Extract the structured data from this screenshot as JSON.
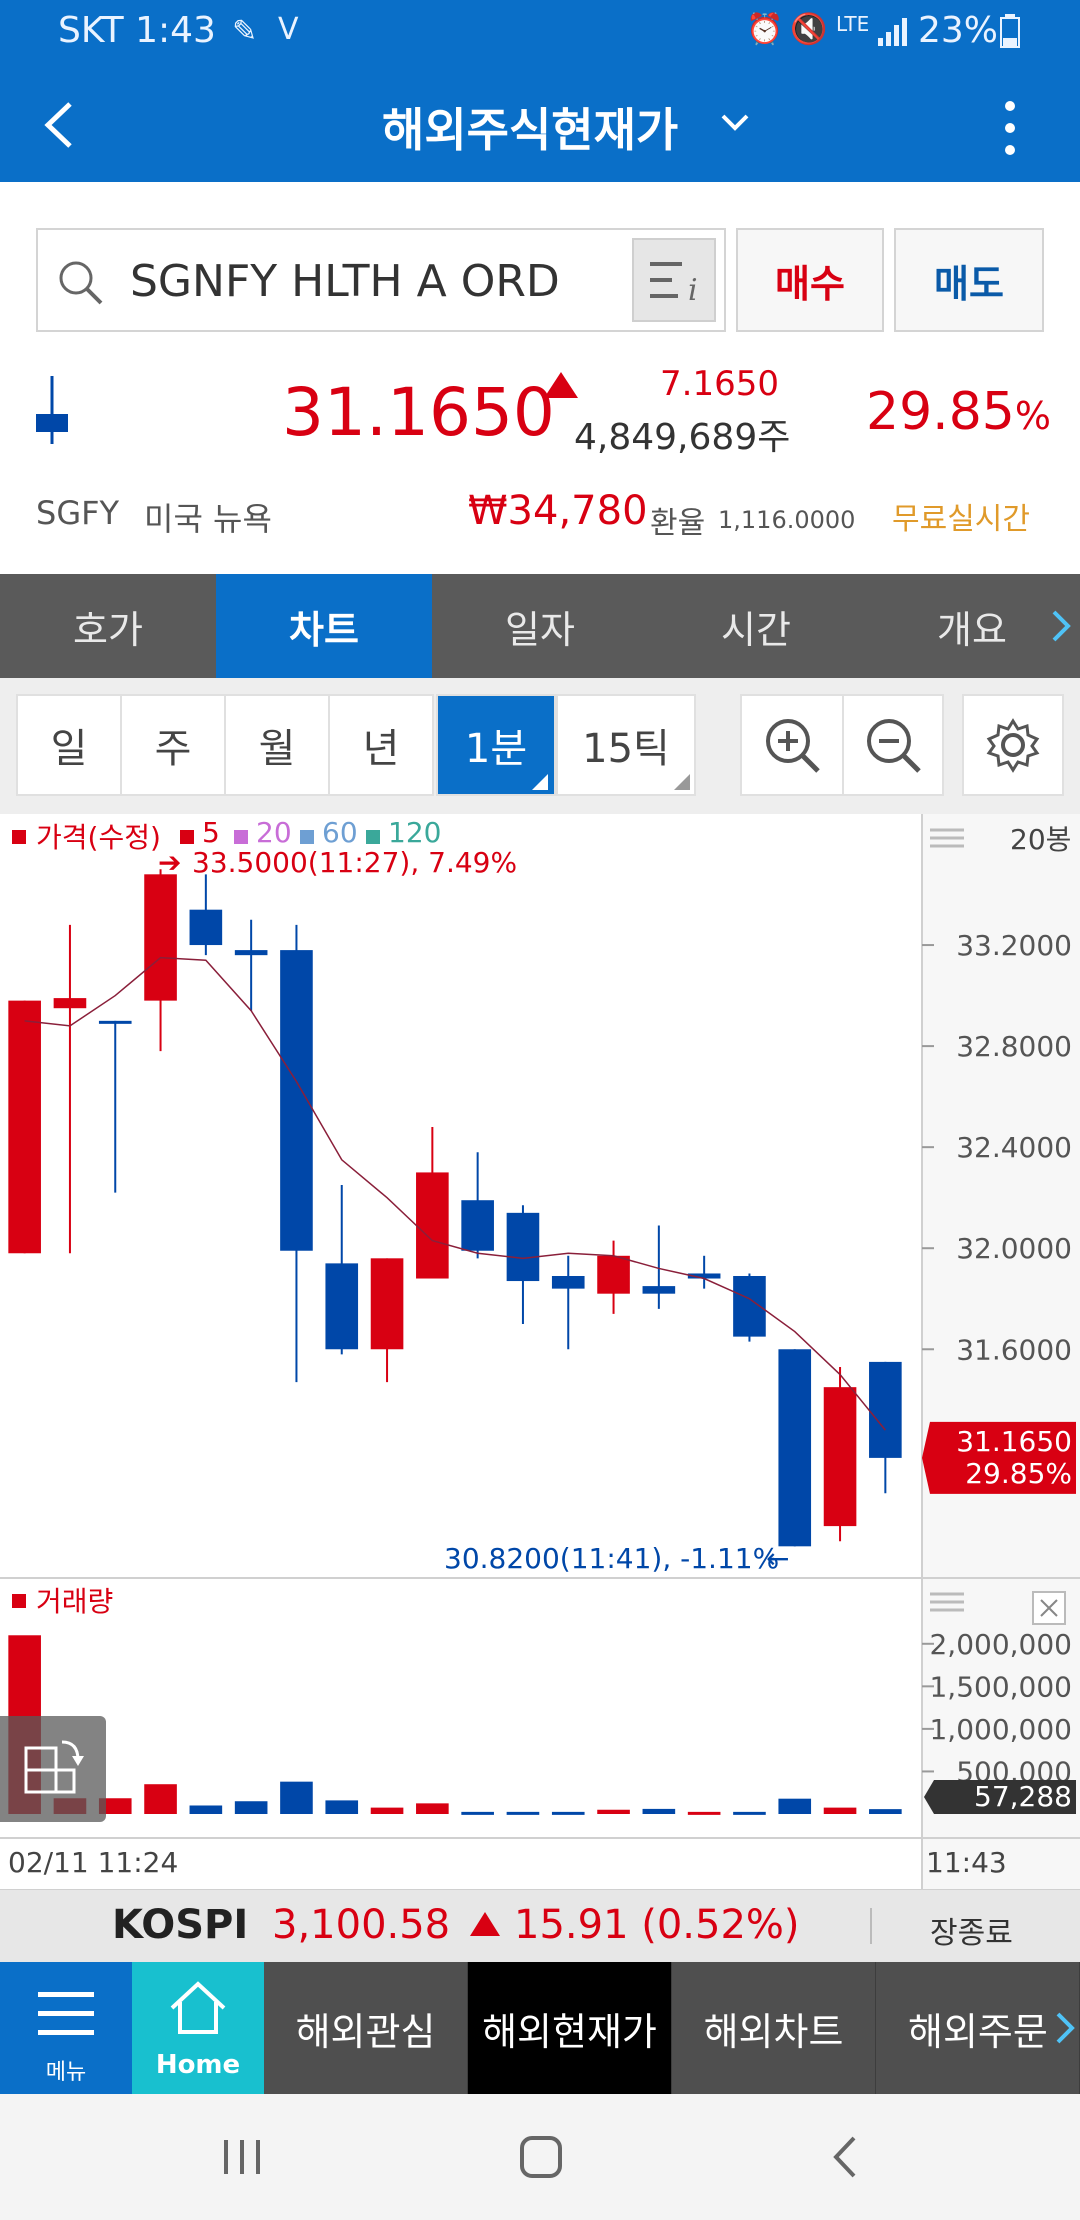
{
  "status": {
    "carrier_time": "SKT 1:43",
    "network": "LTE",
    "battery": "23%"
  },
  "header": {
    "title": "해외주식현재가"
  },
  "search": {
    "symbol": "SGNFY HLTH A ORD",
    "buy_label": "매수",
    "sell_label": "매도"
  },
  "quote": {
    "price": "31.1650",
    "change": "7.1650",
    "volume": "4,849,689주",
    "change_pct": "29.85",
    "pct_sign": "%",
    "ticker": "SGFY",
    "market": "미국 뉴욕",
    "krw_price": "₩34,780",
    "fx_label": "환율",
    "fx_rate": "1,116.0000",
    "realtime_label": "무료실시간"
  },
  "tabs": [
    "호가",
    "차트",
    "일자",
    "시간",
    "개요"
  ],
  "periods": [
    "일",
    "주",
    "월",
    "년",
    "1분",
    "15틱"
  ],
  "chart": {
    "legend_price": "가격(수정)",
    "legend_ma": [
      "5",
      "20",
      "60",
      "120"
    ],
    "count_label": "20봉",
    "high_annotation": "33.5000(11:27), 7.49%",
    "low_annotation": "30.8200(11:41), -1.11%",
    "current_price": "31.1650",
    "current_pct": "29.85%",
    "volume_label": "거래량",
    "current_volume": "57,288",
    "start_time": "02/11 11:24",
    "end_time": "11:43",
    "colors": {
      "up": "#d80012",
      "down": "#0047a8",
      "ma5": "#8a1f3a"
    }
  },
  "chart_data": [
    {
      "type": "candlestick",
      "title": "가격(수정)",
      "y_ticks": [
        31.6,
        32.0,
        32.4,
        32.8,
        33.2
      ],
      "ylim": [
        30.75,
        33.6
      ],
      "candles": [
        {
          "o": 31.98,
          "h": 32.98,
          "l": 31.98,
          "c": 32.98
        },
        {
          "o": 32.95,
          "h": 33.28,
          "l": 31.98,
          "c": 32.99
        },
        {
          "o": 32.9,
          "h": 32.88,
          "l": 32.22,
          "c": 32.89
        },
        {
          "o": 32.98,
          "h": 33.5,
          "l": 32.78,
          "c": 33.48
        },
        {
          "o": 33.34,
          "h": 33.48,
          "l": 33.16,
          "c": 33.2
        },
        {
          "o": 33.18,
          "h": 33.3,
          "l": 32.94,
          "c": 33.16
        },
        {
          "o": 33.18,
          "h": 33.28,
          "l": 31.47,
          "c": 31.99
        },
        {
          "o": 31.94,
          "h": 32.25,
          "l": 31.58,
          "c": 31.6
        },
        {
          "o": 31.6,
          "h": 31.95,
          "l": 31.47,
          "c": 31.96
        },
        {
          "o": 31.88,
          "h": 32.48,
          "l": 31.88,
          "c": 32.3
        },
        {
          "o": 32.19,
          "h": 32.38,
          "l": 31.96,
          "c": 31.99
        },
        {
          "o": 32.14,
          "h": 32.17,
          "l": 31.7,
          "c": 31.87
        },
        {
          "o": 31.89,
          "h": 31.97,
          "l": 31.6,
          "c": 31.84
        },
        {
          "o": 31.82,
          "h": 32.03,
          "l": 31.74,
          "c": 31.97
        },
        {
          "o": 31.85,
          "h": 32.09,
          "l": 31.76,
          "c": 31.82
        },
        {
          "o": 31.9,
          "h": 31.97,
          "l": 31.84,
          "c": 31.88
        },
        {
          "o": 31.89,
          "h": 31.9,
          "l": 31.63,
          "c": 31.65
        },
        {
          "o": 31.6,
          "h": 31.6,
          "l": 30.82,
          "c": 30.82
        },
        {
          "o": 30.9,
          "h": 31.53,
          "l": 30.84,
          "c": 31.45
        },
        {
          "o": 31.55,
          "h": 31.55,
          "l": 31.03,
          "c": 31.17
        }
      ],
      "ma5": [
        32.9,
        32.88,
        33.0,
        33.15,
        33.14,
        32.94,
        32.66,
        32.35,
        32.2,
        32.03,
        31.98,
        31.96,
        31.98,
        31.97,
        31.92,
        31.88,
        31.8,
        31.67,
        31.5,
        31.28
      ]
    },
    {
      "type": "bar",
      "title": "거래량",
      "y_ticks": [
        500000,
        1000000,
        1500000,
        2000000
      ],
      "ylim": [
        0,
        2350000
      ],
      "values": [
        2100000,
        185000,
        185000,
        350000,
        100000,
        150000,
        380000,
        160000,
        75000,
        125000,
        25000,
        25000,
        25000,
        50000,
        60000,
        25000,
        25000,
        180000,
        75000,
        57288
      ],
      "up": [
        true,
        true,
        true,
        true,
        false,
        false,
        false,
        false,
        true,
        true,
        false,
        false,
        false,
        true,
        false,
        true,
        false,
        false,
        true,
        false
      ]
    }
  ],
  "kospi": {
    "name": "KOSPI",
    "value": "3,100.58",
    "change": "15.91 (0.52%)",
    "status": "장종료"
  },
  "bottom_nav": {
    "menu": "메뉴",
    "home": "Home",
    "items": [
      "해외관심",
      "해외현재가",
      "해외차트",
      "해외주문"
    ]
  }
}
